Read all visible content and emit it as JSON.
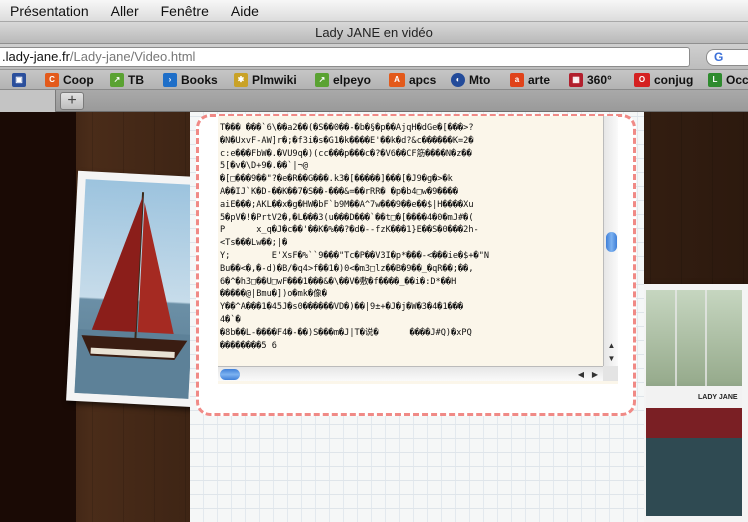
{
  "menubar": {
    "items": [
      "Présentation",
      "Aller",
      "Fenêtre",
      "Aide"
    ]
  },
  "window": {
    "title": "Lady JANE en vidéo"
  },
  "addressbar": {
    "host": ".lady-jane.fr",
    "path": "/Lady-jane/Video.html",
    "search_icon": "google-icon"
  },
  "bookmarks": [
    {
      "label": "",
      "icon": "tv-icon",
      "color": "#2b4f9c"
    },
    {
      "label": "Coop",
      "icon": "coop-icon",
      "color": "#e35a1b"
    },
    {
      "label": "TB",
      "icon": "tb-icon",
      "color": "#5aa232"
    },
    {
      "label": "Books",
      "icon": "books-icon",
      "color": "#1f6fc8"
    },
    {
      "label": "Plmwiki",
      "icon": "wiki-icon",
      "color": "#c9a227"
    },
    {
      "label": "elpeyo",
      "icon": "elpeyo-icon",
      "color": "#5aa232"
    },
    {
      "label": "apcs",
      "icon": "apcs-icon",
      "color": "#e35a1b"
    },
    {
      "label": "Mto",
      "icon": "mto-icon",
      "color": "#234b9a"
    },
    {
      "label": "arte",
      "icon": "arte-icon",
      "color": "#e0431a"
    },
    {
      "label": "360°",
      "icon": "360-icon",
      "color": "#b21f2d"
    },
    {
      "label": "conjug",
      "icon": "conjug-icon",
      "color": "#d52121"
    },
    {
      "label": "Occ",
      "icon": "occ-icon",
      "color": "#2e8b2e"
    }
  ],
  "tabstrip": {
    "new_tab": "+"
  },
  "content": {
    "garbled_lines": [
      "T��� ���`6\\��a2��(�S��0��-�b�§�p��AjqH�dGe�[���>?",
      "�N�UxvF-AW]r�;�f3i�s�G1�k����E'��k�d?&c������K=2�",
      "c:e���FbW�.�VU9q�)(cc���p���c�?�V6��CF筋����N�z��",
      "5[�v�\\D+9�.��`|¬@",
      "�[□���9��\"?�e�R��G���.k3�[�����]���[�J9�g�>�k",
      "A��IJ`K�D-��K��7�S��-���&=��rRR� �p�b4□w�9����",
      "aiE���;AKL��x�g�HW�bF`b9M��A^7w���9��e��$|H����Xu",
      "5�pV�!�PrtV2�,�L���3(u���D���`��t□�[����4�0�mJ#�(",
      "P      x_q�J�c��'��K�%��?�d�--fzK���1}E��S�0���2h-",
      "<Ts���Lw��;|�",
      "Y;        E'XsF�%``9���\"Tc�P��V3I�p*���-<���ie�$+�\"N",
      "Bu��<�,�-d)�B/�q4>f��1�)0<�m3□lz��B�9��_�qR��;��,",
      "6�^�h3□��U□wF���1���&�\\��V�敷�f����_��i�:D*��H",
      "�����@|Bmu�])o�mk�像�",
      "Y��^A���1�45J�s0������VD�)��|9±+�J�j�W�3�4�1���",
      "4�`�",
      "�8b��L-����F4�-��)S���m�J|T�说�      ����J#Q)�xPQ",
      "��������5 6"
    ]
  },
  "photos": {
    "right_caption": "LADY JANE"
  }
}
